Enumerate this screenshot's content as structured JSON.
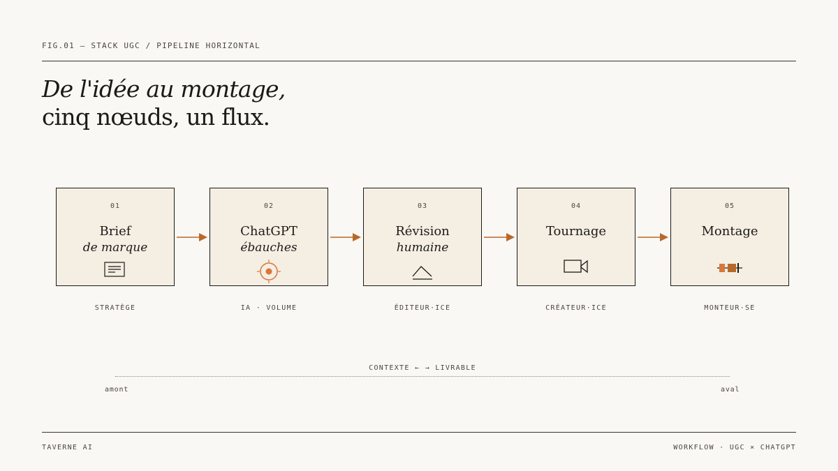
{
  "header": {
    "figure_label": "FIG.01 — STACK UGC / PIPELINE HORIZONTAL",
    "headline_line1": "De l'idée au montage,",
    "headline_line2": "cinq nœuds, un flux."
  },
  "pipeline": {
    "nodes": [
      {
        "number": "01",
        "title": "Brief",
        "subtitle": "de marque",
        "role": "STRATÈGE",
        "icon": "document-icon"
      },
      {
        "number": "02",
        "title": "ChatGPT",
        "subtitle": "ébauches",
        "role": "IA · VOLUME",
        "icon": "target-icon"
      },
      {
        "number": "03",
        "title": "Révision",
        "subtitle": "humaine",
        "role": "ÉDITEUR·ICE",
        "icon": "triangle-edit-icon"
      },
      {
        "number": "04",
        "title": "Tournage",
        "subtitle": "",
        "role": "CRÉATEUR·ICE",
        "icon": "video-camera-icon"
      },
      {
        "number": "05",
        "title": "Montage",
        "subtitle": "",
        "role": "MONTEUR·SE",
        "icon": "timeline-icon"
      }
    ]
  },
  "context_axis": {
    "label": "CONTEXTE ← → LIVRABLE",
    "start": "amont",
    "end": "aval"
  },
  "footer": {
    "left": "TAVERNE AI",
    "right": "WORKFLOW · UGC × CHATGPT"
  },
  "colors": {
    "accent": "#b8692a",
    "accent_light": "#d9773a",
    "ink": "#1c1a17",
    "node_fill": "#f4eee3",
    "background": "#faf8f4"
  }
}
